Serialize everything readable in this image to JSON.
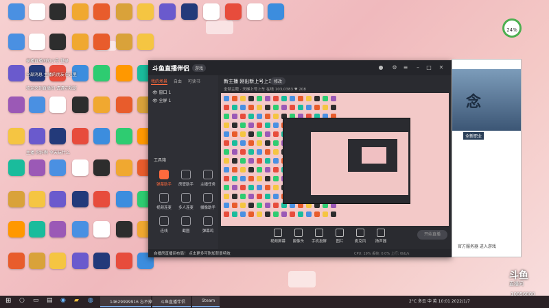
{
  "desktop_icons": [
    {
      "label": "",
      "color": "#4a90e2"
    },
    {
      "label": "",
      "color": "#ffffff"
    },
    {
      "label": "",
      "color": "#2d2d2d"
    },
    {
      "label": "",
      "color": "#f0a830"
    },
    {
      "label": "",
      "color": "#e85c2c"
    },
    {
      "label": "",
      "color": "#d9a23a"
    },
    {
      "label": "",
      "color": "#f5c542"
    },
    {
      "label": "",
      "color": "#6a5acd"
    },
    {
      "label": "",
      "color": "#233a7a"
    },
    {
      "label": "",
      "color": "#ffffff"
    },
    {
      "label": "",
      "color": "#e74c3c"
    },
    {
      "label": "",
      "color": "#ffffff"
    },
    {
      "label": "",
      "color": "#3c8dde"
    }
  ],
  "chat_lines": [
    "录播直播间的小号 登录",
    "全部消息 主播的朋友在这里",
    "欢迎来到直播间 请遵守规定",
    "主播 你好啊 今天玩什么"
  ],
  "app": {
    "title": "斗鱼直播伴侣",
    "title_badge": "游戏",
    "scene_tabs": [
      "我的场景",
      "自由",
      "可读书"
    ],
    "scenes": [
      "窗口 1",
      "全屏 1"
    ],
    "tools_title": "工具箱",
    "tools": [
      "弹幕助手",
      "房管助手",
      "主播任务",
      "视频连麦",
      "多人连麦",
      "摄像助手",
      "连线",
      "截图",
      "弹幕鸡"
    ],
    "stream_title": "新主播 刚出新上号上车",
    "stream_button": "修改",
    "stream_meta": "全部主题 · 天梯上号上车   在线 103,0383   ♥ 208",
    "bottom_tools": [
      "视频屏幕",
      "摄像头",
      "手机投屏",
      "图片",
      "麦克风",
      "扬声器"
    ],
    "go_live": "开始直播",
    "status": "自播房直播间布局！  点击更多可附加背景特效",
    "stats": "CPU: 19%  丢帧: 0.0%  上行: 0kb/s"
  },
  "game_window": {
    "art_text": "念",
    "banner": "全新职业",
    "bottom_text": "官方服务器 进入游戏"
  },
  "ring_widget": "24%",
  "watermark": {
    "brand": "斗鱼",
    "sub": "直播间",
    "room": "10856880"
  },
  "taskbar": {
    "windows": [
      "14629999916 忘不掉...",
      "斗鱼直播伴侣",
      "Steam"
    ],
    "tray": "2°C 多云  中  英  10:01  2022/1/7"
  }
}
